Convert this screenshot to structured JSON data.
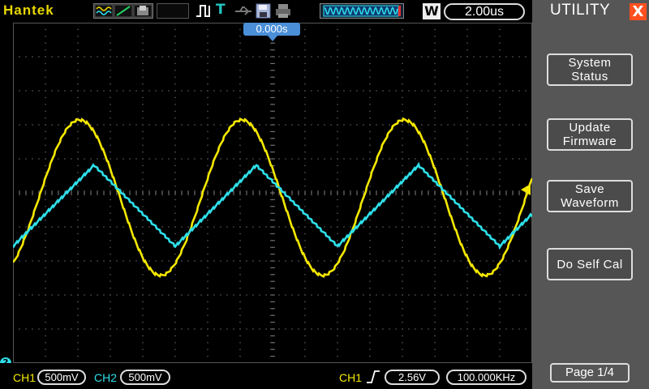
{
  "header": {
    "brand": "Hantek",
    "w_label": "W",
    "timebase": "2.00us",
    "trigger_position": "0.000s"
  },
  "side_menu": {
    "title": "UTILITY",
    "close_label": "X",
    "buttons": [
      {
        "line1": "System",
        "line2": "Status"
      },
      {
        "line1": "Update",
        "line2": "Firmware"
      },
      {
        "line1": "Save",
        "line2": "Waveform"
      },
      {
        "line1": "Do Self Cal",
        "line2": ""
      }
    ],
    "page": "Page 1/4"
  },
  "status": {
    "ch2_marker": "2",
    "ch1_label": "CH1",
    "ch1_scale": "500mV",
    "ch2_label": "CH2",
    "ch2_scale": "500mV",
    "trig_source": "CH1",
    "trig_level": "2.56V",
    "frequency": "100.000KHz"
  },
  "colors": {
    "ch1": "#f4e800",
    "ch2": "#2ee0ea",
    "grid": "#7a7a7a",
    "accent": "#4a8fd8",
    "close": "#ff5020"
  },
  "chart_data": {
    "type": "line",
    "series": [
      {
        "name": "CH1",
        "shape": "sine",
        "frequency_khz": 100.0,
        "color": "#f4e800"
      },
      {
        "name": "CH2",
        "shape": "triangle",
        "frequency_khz": 100.0,
        "color": "#2ee0ea"
      }
    ],
    "x_units": "us",
    "xlim": [
      -10,
      10
    ],
    "grid": "dotted"
  }
}
